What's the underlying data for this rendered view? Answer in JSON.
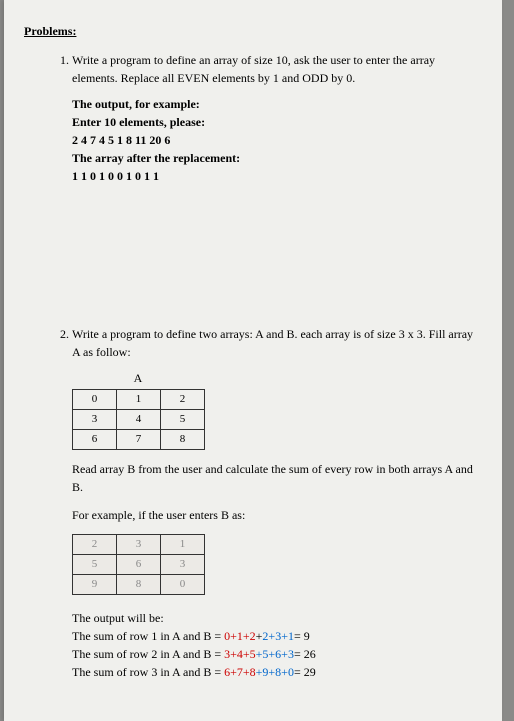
{
  "section_title": "Problems:",
  "problem1": {
    "prompt": "Write a program to define an array of size 10, ask the user to enter the array elements. Replace all EVEN elements by 1 and ODD by 0.",
    "ex_label": "The output, for example:",
    "ex_line1": "Enter 10 elements, please:",
    "ex_line2": "2 4 7 4 5 1 8 11 20 6",
    "ex_line3": "The array after the replacement:",
    "ex_line4": "1 1 0 1 0 0 1 0 1 1"
  },
  "problem2": {
    "prompt": "Write a program to define two arrays: A and B. each array is of size 3 x 3. Fill array A as follow:",
    "matrix_a_label": "A",
    "matrix_a": [
      [
        "0",
        "1",
        "2"
      ],
      [
        "3",
        "4",
        "5"
      ],
      [
        "6",
        "7",
        "8"
      ]
    ],
    "read_text": "Read array B from the user and calculate the sum of every row in both arrays A and B.",
    "example_text": "For example, if the user enters B as:",
    "matrix_b": [
      [
        "2",
        "3",
        "1"
      ],
      [
        "5",
        "6",
        "3"
      ],
      [
        "9",
        "8",
        "0"
      ]
    ],
    "output_label": "The output will be:",
    "row1_prefix": "The sum of row 1 in A and B = ",
    "row1_a": "0+1+2",
    "row1_plus": "+",
    "row1_b": "2+3+1",
    "row1_eq": "= 9",
    "row2_prefix": "The sum of row 2 in A and B = ",
    "row2_a": "3+4+5",
    "row2_b": "+5+6+3",
    "row2_eq": "= 26",
    "row3_prefix": "The sum of row 3 in A and B = ",
    "row3_a": "6+7+8",
    "row3_b": "+9+8+0",
    "row3_eq": "= 29"
  },
  "chart_data": {
    "type": "table",
    "tables": [
      {
        "name": "A",
        "rows": [
          [
            0,
            1,
            2
          ],
          [
            3,
            4,
            5
          ],
          [
            6,
            7,
            8
          ]
        ]
      },
      {
        "name": "B",
        "rows": [
          [
            2,
            3,
            1
          ],
          [
            5,
            6,
            3
          ],
          [
            9,
            8,
            0
          ]
        ]
      }
    ]
  }
}
